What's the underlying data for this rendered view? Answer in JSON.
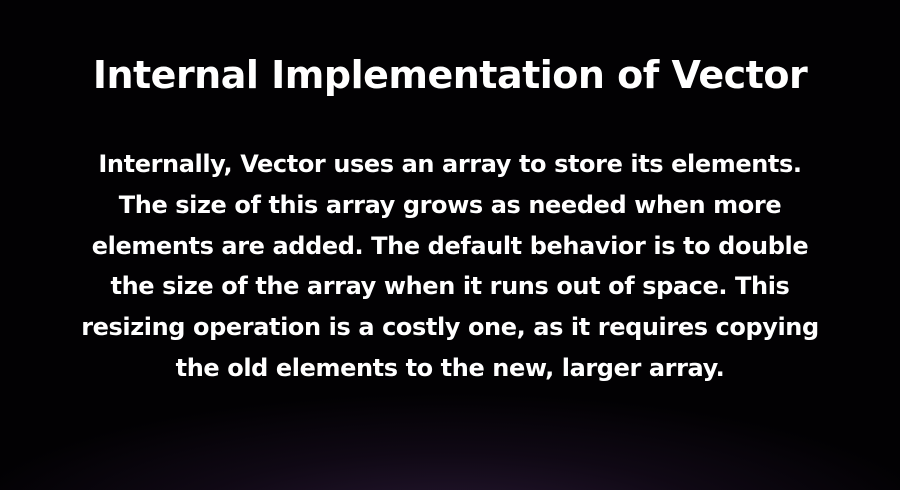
{
  "slide": {
    "title": "Internal Implementation of Vector",
    "paragraph_lines": [
      "Internally, Vector uses an array to store its elements.",
      "The size of this array grows as needed when more",
      "elements are added. The default behavior is to double",
      "the size of the array when it runs out of space. This",
      "resizing operation is a costly one, as it requires copying",
      "the old elements to the new, larger array."
    ]
  }
}
